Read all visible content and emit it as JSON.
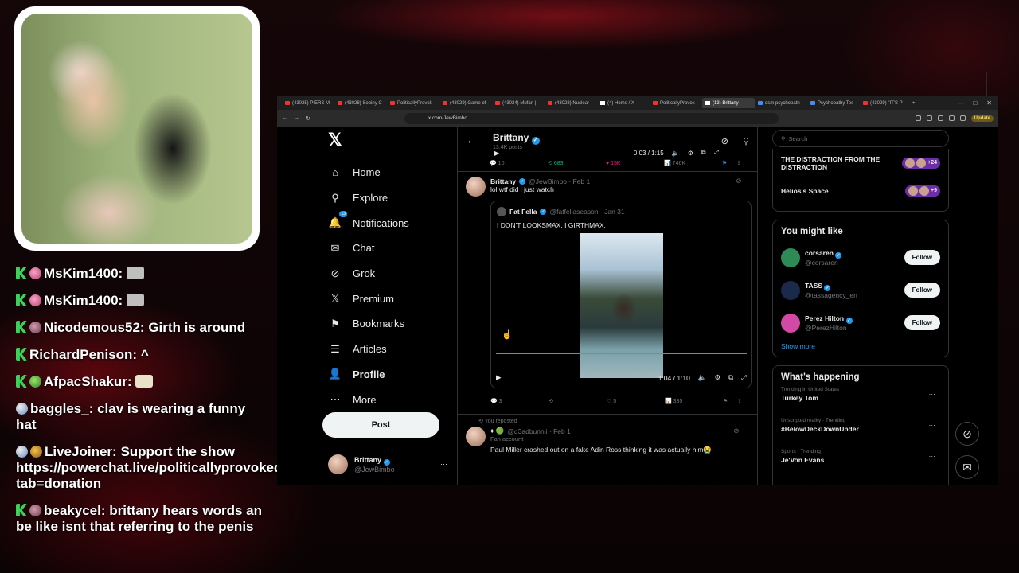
{
  "chat": [
    {
      "user": "MsKim1400:",
      "text": "",
      "badges": [
        "b-k",
        "b-c"
      ],
      "emote": "emote"
    },
    {
      "user": "MsKim1400:",
      "text": "",
      "badges": [
        "b-k",
        "b-c"
      ],
      "emote": "emote"
    },
    {
      "user": "Nicodemous52:",
      "text": "Girth is around",
      "badges": [
        "b-k",
        "b-r"
      ]
    },
    {
      "user": "RichardPenison:",
      "text": "^",
      "badges": [
        "b-k"
      ]
    },
    {
      "user": "AfpacShakur:",
      "text": "",
      "badges": [
        "b-k",
        "b-g"
      ],
      "emote": "emote2"
    },
    {
      "user": "baggles_:",
      "text": "clav is wearing a funny hat",
      "badges": [
        "b-m"
      ]
    },
    {
      "user": "LiveJoiner:",
      "text": "Support the show https://powerchat.live/politicallyprovoked?tab=donation",
      "badges": [
        "b-m",
        "b-b"
      ]
    },
    {
      "user": "beakycel:",
      "text": "brittany hears words an be like isnt that referring to the penis",
      "badges": [
        "b-k",
        "b-r"
      ]
    }
  ],
  "tabs": [
    "(43025) PIERS M",
    "(43028) Sobiny C",
    "PoliticallyProvok",
    "(43029) Game of",
    "(43024) Mufan |",
    "(43028) Nuclear",
    "(4) Home / X",
    "PoliticallyProvok",
    "(13) Brittany",
    "dsm psychopath",
    "Psychopathy Tes",
    "(43029) \"IT'S P"
  ],
  "active_tab": 8,
  "address": {
    "url": "x.com/JewBimbo",
    "update": "Update"
  },
  "nav": {
    "items": [
      {
        "label": "Home",
        "icon": "⌂",
        "name": "home"
      },
      {
        "label": "Explore",
        "icon": "⚲",
        "name": "explore"
      },
      {
        "label": "Notifications",
        "icon": "🔔",
        "name": "notifications"
      },
      {
        "label": "Chat",
        "icon": "✉",
        "name": "chat"
      },
      {
        "label": "Grok",
        "icon": "⊘",
        "name": "grok"
      },
      {
        "label": "Premium",
        "icon": "𝕏",
        "name": "premium"
      },
      {
        "label": "Bookmarks",
        "icon": "⚑",
        "name": "bookmarks"
      },
      {
        "label": "Articles",
        "icon": "☰",
        "name": "articles"
      },
      {
        "label": "Profile",
        "icon": "👤",
        "name": "profile"
      },
      {
        "label": "More",
        "icon": "⋯",
        "name": "more"
      }
    ],
    "notif_count": "13",
    "post": "Post",
    "me": {
      "name": "Brittany",
      "handle": "@JewBimbo"
    }
  },
  "header": {
    "name": "Brittany",
    "posts": "13.4K posts"
  },
  "player_top": {
    "time": "0:03 / 1:15"
  },
  "stats_top": [
    "10",
    "683",
    "15K",
    "746K"
  ],
  "tweet": {
    "name": "Brittany",
    "handle": "@JewBimbo · Feb 1",
    "text": "lol wtf did i just watch",
    "quote": {
      "name": "Fat Fella",
      "handle": "@fatfellaseason · Jan 31",
      "text": "I DON'T LOOKSMAX. I GIRTHMAX.",
      "time": "1:04 / 1:10"
    },
    "stats": [
      "3",
      "",
      "5",
      "385"
    ]
  },
  "repost": {
    "label": "You reposted",
    "name": "♦ 🟢",
    "handle": "@d3adbunnii · Feb 1",
    "fan": "Fan account",
    "text": "Paul Miller crashed out on a fake Adin Ross thinking it was actually him😭"
  },
  "right": {
    "search": "Search",
    "spaces": [
      {
        "title": "THE DISTRACTION FROM THE DISTRACTION",
        "count": "+24"
      },
      {
        "title": "Helios's Space",
        "count": "+9"
      }
    ],
    "might_like_title": "You might like",
    "suggestions": [
      {
        "name": "corsaren",
        "handle": "@corsaren",
        "color": "#2e8b57"
      },
      {
        "name": "TASS",
        "handle": "@tassagency_en",
        "color": "#1b2a4a"
      },
      {
        "name": "Perez Hilton",
        "handle": "@PerezHilton",
        "color": "#d34aa6"
      }
    ],
    "follow": "Follow",
    "show_more": "Show more",
    "happening_title": "What's happening",
    "trends": [
      {
        "cat": "Trending in United States",
        "topic": "Turkey Tom"
      },
      {
        "cat": "Unscripted reality · Trending",
        "topic": "#BelowDeckDownUnder"
      },
      {
        "cat": "Sports · Trending",
        "topic": "Je'Von Evans"
      }
    ]
  },
  "colors": {
    "accent": "#1d9bf0",
    "like": "#f91880",
    "repost": "#00ba7c"
  }
}
